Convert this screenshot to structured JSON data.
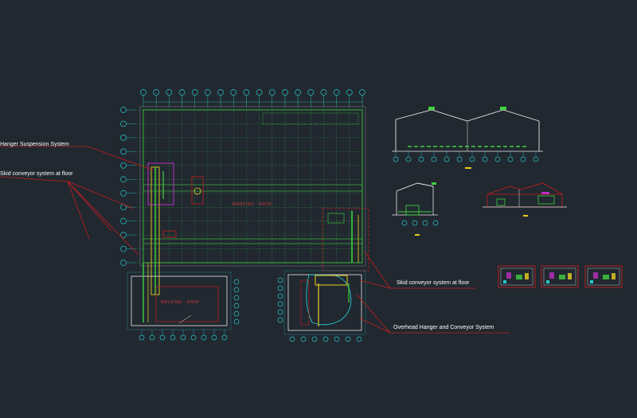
{
  "callouts": {
    "hanger_suspension": "Hanger Suspension System",
    "skid_floor_left": "Skid conveyor system at floor",
    "skid_floor_right": "Skid conveyor system at floor",
    "overhead_hanger": "Overhead Hanger and Conveyor System"
  },
  "room_labels": {
    "painting_shop": "PAINTING - SHOP",
    "welding_shop": "WELDING - SHOP"
  },
  "colors": {
    "background": "#212830",
    "grid_cyan": "#27c8cc",
    "equipment_green": "#3ed23e",
    "leader_red": "#c41f1f",
    "magenta": "#c030c0",
    "yellow": "#e8d020",
    "frame_white": "#e8e8e8"
  }
}
